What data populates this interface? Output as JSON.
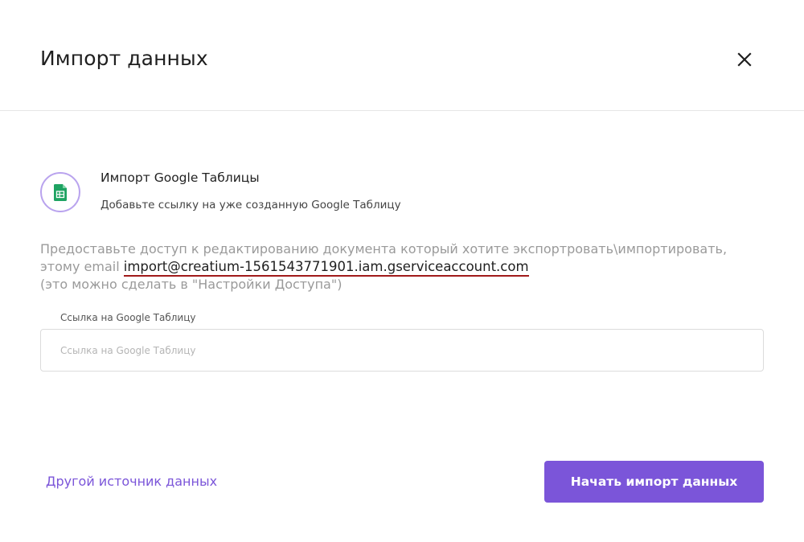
{
  "dialog": {
    "title": "Импорт данных",
    "close_icon": "close-icon"
  },
  "source": {
    "icon": "google-sheets-icon",
    "title": "Импорт Google Таблицы",
    "subtitle": "Добавьте ссылку на уже созданную Google Таблицу"
  },
  "info": {
    "line1": "Предоставьте доступ к редактированию документа который хотите экспортровать\\импортировать,",
    "line2_prefix": "этому email ",
    "email": "import@creatium-1561543771901.iam.gserviceaccount.com",
    "line3": "(это можно сделать в \"Настройки Доступа\")"
  },
  "url_field": {
    "label": "Ссылка на Google Таблицу",
    "placeholder": "Ссылка на Google Таблицу",
    "value": ""
  },
  "footer": {
    "other_source_label": "Другой источник данных",
    "start_label": "Начать импорт данных"
  },
  "colors": {
    "accent": "#7b55d9",
    "icon_ring": "#b9a3ee",
    "sheets_green": "#1ea362",
    "email_underline": "#a11a1a"
  }
}
